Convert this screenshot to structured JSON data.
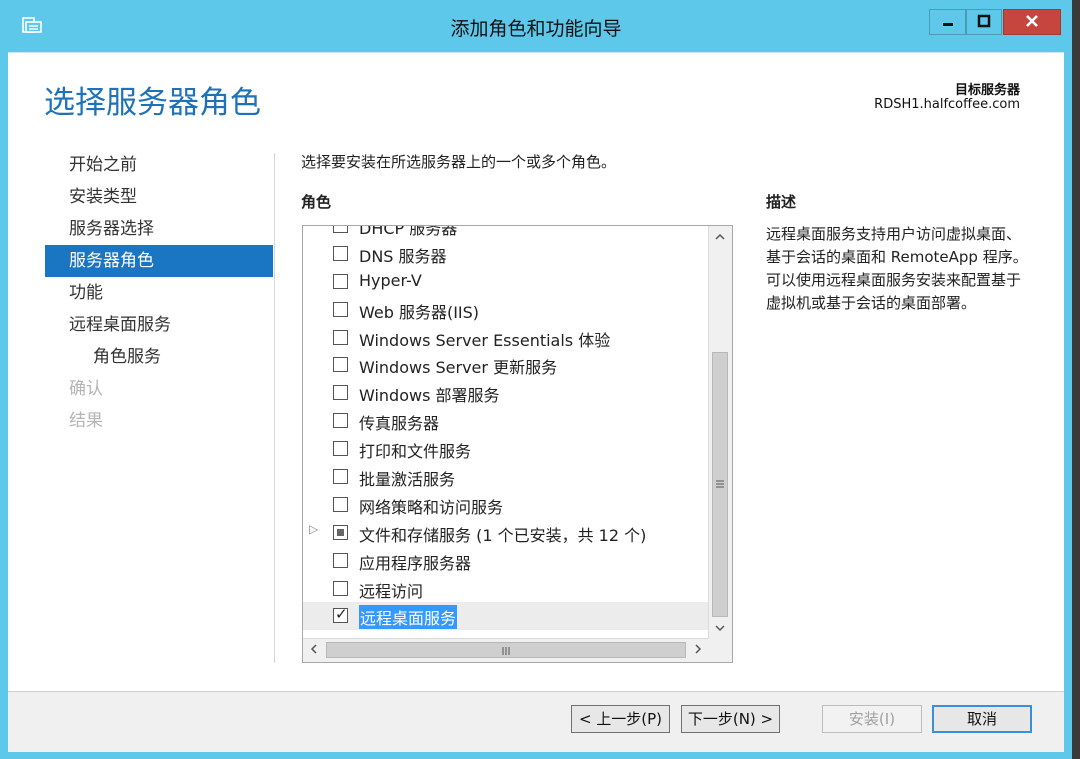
{
  "window": {
    "title": "添加角色和功能向导",
    "controls": [
      "minimize-icon",
      "maximize-icon",
      "close-icon"
    ]
  },
  "header": {
    "page_title": "选择服务器角色",
    "target_label": "目标服务器",
    "target_server": "RDSH1.halfcoffee.com"
  },
  "nav": [
    {
      "label": "开始之前",
      "state": "normal"
    },
    {
      "label": "安装类型",
      "state": "normal"
    },
    {
      "label": "服务器选择",
      "state": "normal"
    },
    {
      "label": "服务器角色",
      "state": "active"
    },
    {
      "label": "功能",
      "state": "normal"
    },
    {
      "label": "远程桌面服务",
      "state": "normal"
    },
    {
      "label": "角色服务",
      "state": "sub"
    },
    {
      "label": "确认",
      "state": "disabled"
    },
    {
      "label": "结果",
      "state": "disabled"
    }
  ],
  "main": {
    "instruction": "选择要安装在所选服务器上的一个或多个角色。",
    "roles_heading": "角色",
    "description_heading": "描述",
    "description": "远程桌面服务支持用户访问虚拟桌面、基于会话的桌面和 RemoteApp 程序。可以使用远程桌面服务安装来配置基于虚拟机或基于会话的桌面部署。"
  },
  "roles": [
    {
      "label": "DHCP 服务器",
      "state": "unchecked"
    },
    {
      "label": "DNS 服务器",
      "state": "unchecked"
    },
    {
      "label": "Hyper-V",
      "state": "unchecked"
    },
    {
      "label": "Web 服务器(IIS)",
      "state": "unchecked"
    },
    {
      "label": "Windows Server Essentials 体验",
      "state": "unchecked"
    },
    {
      "label": "Windows Server 更新服务",
      "state": "unchecked"
    },
    {
      "label": "Windows 部署服务",
      "state": "unchecked"
    },
    {
      "label": "传真服务器",
      "state": "unchecked"
    },
    {
      "label": "打印和文件服务",
      "state": "unchecked"
    },
    {
      "label": "批量激活服务",
      "state": "unchecked"
    },
    {
      "label": "网络策略和访问服务",
      "state": "unchecked"
    },
    {
      "label": "文件和存储服务 (1 个已安装，共 12 个)",
      "state": "partial",
      "expandable": true
    },
    {
      "label": "应用程序服务器",
      "state": "unchecked"
    },
    {
      "label": "远程访问",
      "state": "unchecked"
    },
    {
      "label": "远程桌面服务",
      "state": "checked",
      "selected": true
    }
  ],
  "footer": {
    "prev": "< 上一步(P)",
    "next": "下一步(N) >",
    "install": "安装(I)",
    "cancel": "取消"
  },
  "colors": {
    "titlebar": "#5ec8ea",
    "accent": "#1a75c2",
    "page_title": "#1e72b8",
    "close": "#c6463d"
  }
}
